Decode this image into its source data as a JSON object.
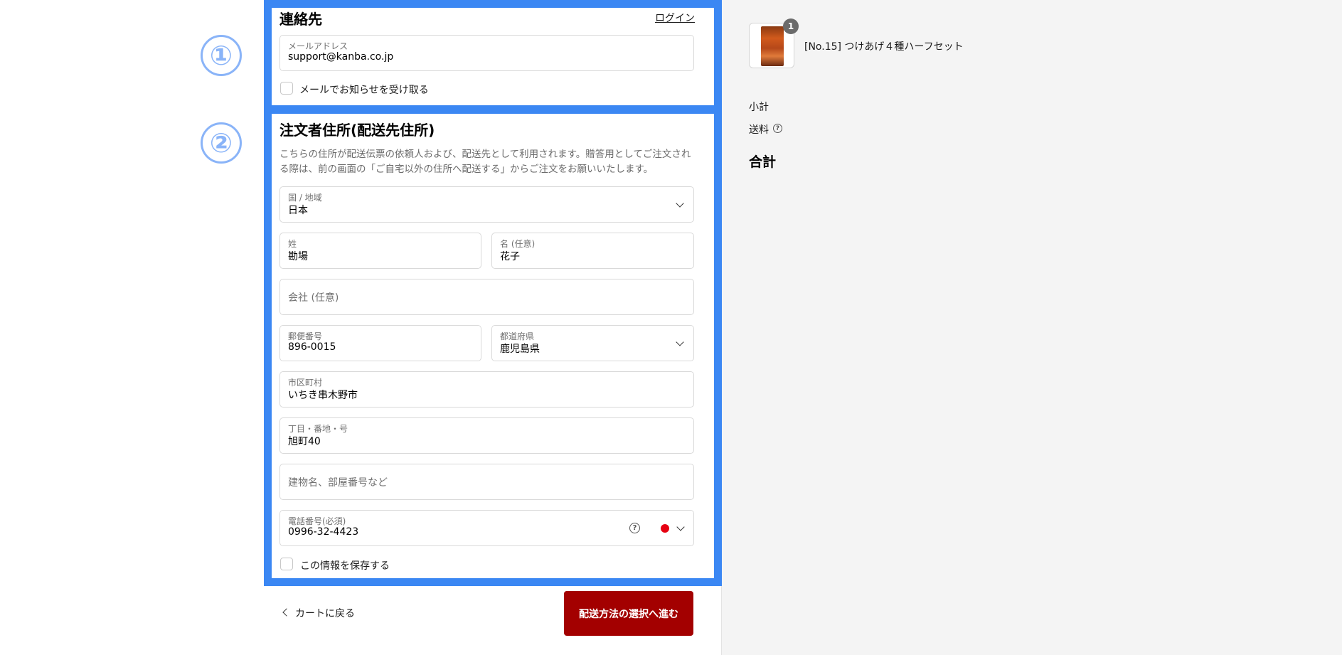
{
  "colors": {
    "highlight": "#3b87f3",
    "step_marker": "#8ab4f8",
    "primary_button": "#a30000"
  },
  "annotations": {
    "step1": "①",
    "step2": "②"
  },
  "contact": {
    "title": "連絡先",
    "login_link": "ログイン",
    "email": {
      "label": "メールアドレス",
      "value": "support@kanba.co.jp"
    },
    "newsletter_label": "メールでお知らせを受け取る"
  },
  "address": {
    "title": "注文者住所(配送先住所)",
    "description": "こちらの住所が配送伝票の依頼人および、配送先として利用されます。贈答用としてご注文される際は、前の画面の「ご自宅以外の住所へ配送する」からご注文をお願いいたします。",
    "country": {
      "label": "国 / 地域",
      "value": "日本"
    },
    "last_name": {
      "label": "姓",
      "value": "勘場"
    },
    "first_name": {
      "label": "名 (任意)",
      "value": "花子"
    },
    "company": {
      "placeholder": "会社 (任意)"
    },
    "postal_code": {
      "label": "郵便番号",
      "value": "896-0015"
    },
    "prefecture": {
      "label": "都道府県",
      "value": "鹿児島県"
    },
    "city": {
      "label": "市区町村",
      "value": "いちき串木野市"
    },
    "street": {
      "label": "丁目・番地・号",
      "value": "旭町40"
    },
    "building": {
      "placeholder": "建物名、部屋番号など"
    },
    "phone": {
      "label": "電話番号(必須)",
      "value": "0996-32-4423",
      "help_icon": "?"
    },
    "save_info_label": "この情報を保存する"
  },
  "footer": {
    "back_label": "カートに戻る",
    "next_label": "配送方法の選択へ進む"
  },
  "order_summary": {
    "item": {
      "name": "[No.15] つけあげ４種ハーフセット",
      "quantity": "1"
    },
    "subtotal_label": "小計",
    "shipping_label": "送料",
    "shipping_help": "?",
    "total_label": "合計"
  }
}
